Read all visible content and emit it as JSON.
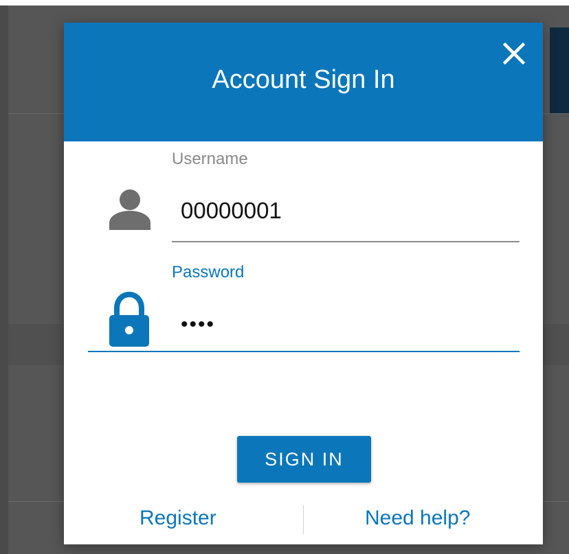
{
  "dialog": {
    "title": "Account Sign In",
    "close_icon": "close-icon"
  },
  "form": {
    "username": {
      "label": "Username",
      "value": "00000001",
      "icon": "user-icon"
    },
    "password": {
      "label": "Password",
      "masked_value": "••••",
      "icon": "lock-icon"
    },
    "submit_label": "SIGN IN"
  },
  "footer": {
    "register_label": "Register",
    "help_label": "Need help?"
  },
  "colors": {
    "accent": "#0b76ba",
    "overlay": "#565656",
    "label_inactive": "#8a8a8a"
  }
}
